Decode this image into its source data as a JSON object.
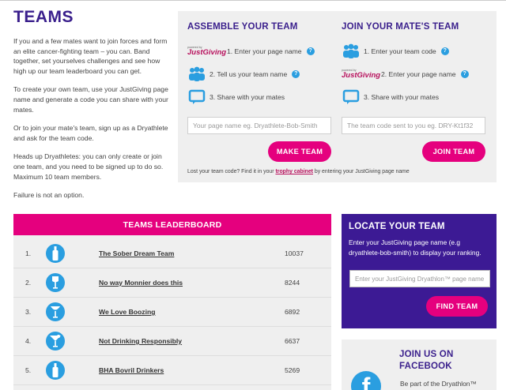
{
  "intro": {
    "title": "TEAMS",
    "p1": "If you and a few mates want to join forces and form an elite cancer-fighting team – you can. Band together, set yourselves challenges and see how high up our team leaderboard you can get.",
    "p2": "To create your own team, use your JustGiving page name and generate a code you can share with your mates.",
    "p3": "Or to join your mate's team, sign up as a Dryathlete and ask for the team code.",
    "p4": "Heads up Dryathletes: you can only create or join one team, and you need to be signed up to do so. Maximum 10 team members.",
    "p5": "Failure is not an option."
  },
  "assemble": {
    "title": "ASSEMBLE YOUR TEAM",
    "powered": "powered by",
    "brand": "JustGiving",
    "step1": "1. Enter your page name",
    "step2": "2. Tell us your team name",
    "step3": "3. Share with your mates",
    "placeholder": "Your page name eg. Dryathlete-Bob-Smith",
    "button": "MAKE TEAM"
  },
  "join": {
    "title": "JOIN YOUR MATE'S TEAM",
    "powered": "powered by",
    "brand": "JustGiving",
    "step1": "1. Enter your team code",
    "step2": "2. Enter your page name",
    "step3": "3. Share with your mates",
    "placeholder": "The team code sent to you eg. DRY-Kt1f32",
    "button": "JOIN TEAM"
  },
  "help_glyph": "?",
  "lost": {
    "before": "Lost your team code? Find it in your ",
    "link": "trophy cabinet",
    "after": " by entering your JustGiving page name"
  },
  "leaderboard": {
    "title": "TEAMS LEADERBOARD",
    "rows": [
      {
        "rank": "1.",
        "name": "The Sober Dream Team",
        "score": "10037",
        "icon": "bottle-icon"
      },
      {
        "rank": "2.",
        "name": "No way Monnier does this",
        "score": "8244",
        "icon": "wine-glass-icon"
      },
      {
        "rank": "3.",
        "name": "We Love Boozing",
        "score": "6892",
        "icon": "wine-glass-icon"
      },
      {
        "rank": "4.",
        "name": "Not Drinking Responsibly",
        "score": "6637",
        "icon": "cocktail-glass-icon"
      },
      {
        "rank": "5.",
        "name": "BHA Bovril Drinkers",
        "score": "5269",
        "icon": "bottle-icon"
      }
    ]
  },
  "locate": {
    "title": "LOCATE YOUR TEAM",
    "text": "Enter your JustGiving page name (e.g dryathlete-bob-smith) to display your ranking.",
    "placeholder": "Enter your JustGiving Dryathlon™ page name",
    "button": "FIND TEAM"
  },
  "facebook": {
    "title": "JOIN US ON FACEBOOK",
    "sub": "Be part of the Dryathlon™",
    "logo": "f"
  },
  "colors": {
    "purple": "#3c1a94",
    "pink": "#e5007e",
    "blue": "#2a9ee0",
    "grey": "#efefef"
  }
}
